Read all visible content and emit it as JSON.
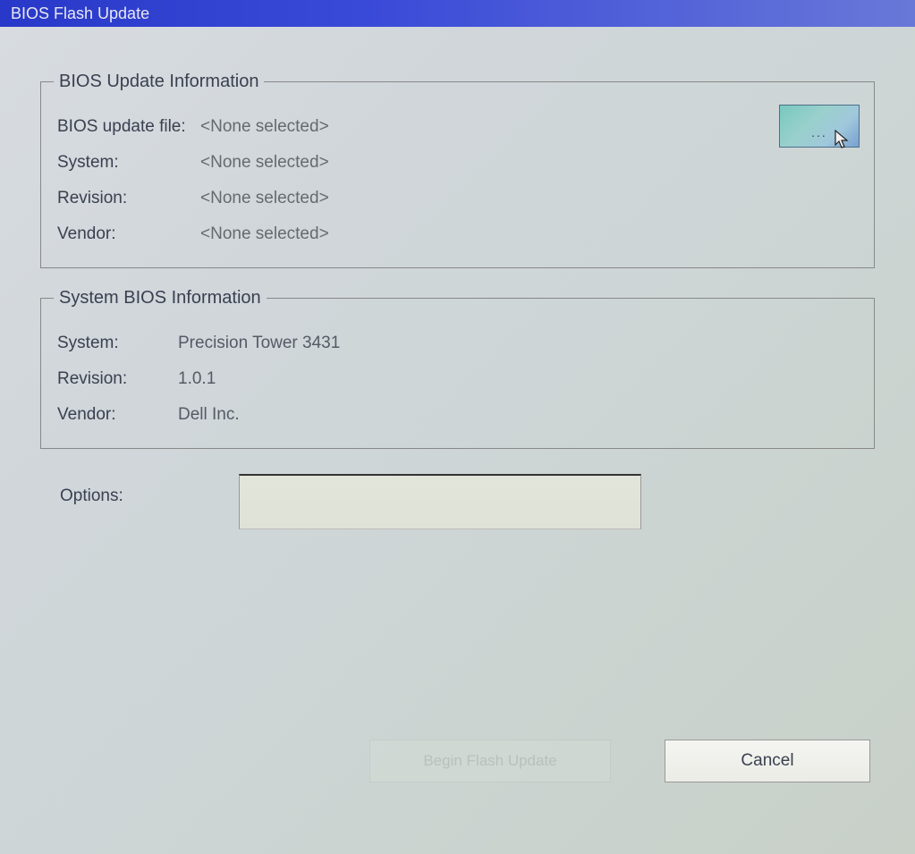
{
  "window": {
    "title": "BIOS Flash Update"
  },
  "update_info": {
    "legend": "BIOS Update Information",
    "file_label": "BIOS update file:",
    "file_value": "<None selected>",
    "system_label": "System:",
    "system_value": "<None selected>",
    "revision_label": "Revision:",
    "revision_value": "<None selected>",
    "vendor_label": "Vendor:",
    "vendor_value": "<None selected>",
    "browse_label": "..."
  },
  "system_info": {
    "legend": "System BIOS Information",
    "system_label": "System:",
    "system_value": "Precision Tower 3431",
    "revision_label": "Revision:",
    "revision_value": "1.0.1",
    "vendor_label": "Vendor:",
    "vendor_value": "Dell Inc."
  },
  "options": {
    "label": "Options:",
    "value": ""
  },
  "buttons": {
    "begin": "Begin Flash Update",
    "cancel": "Cancel"
  }
}
